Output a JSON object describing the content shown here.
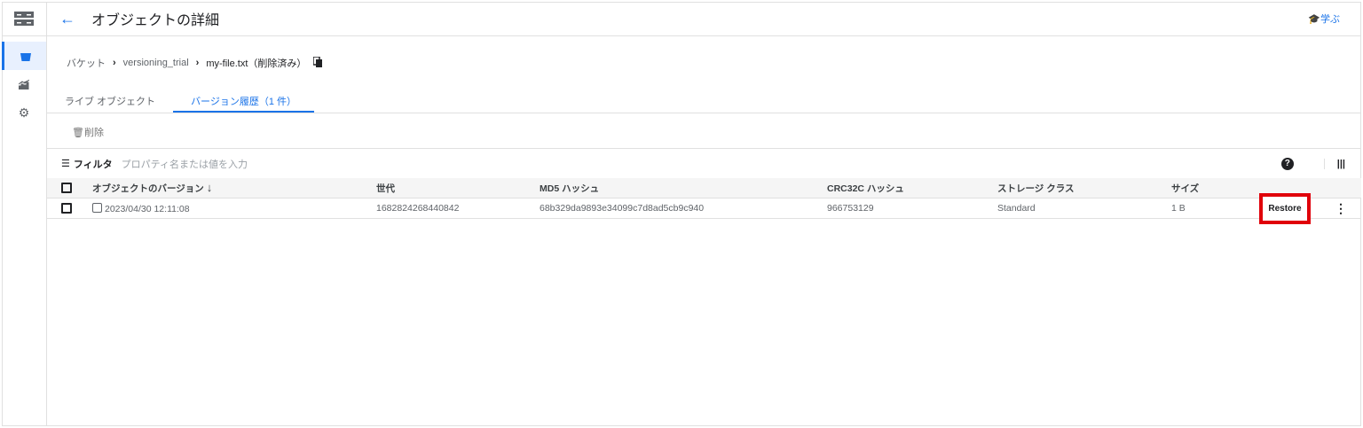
{
  "header": {
    "title": "オブジェクトの詳細",
    "learn": "学ぶ"
  },
  "breadcrumb": {
    "bucket": "バケット",
    "bucket_name": "versioning_trial",
    "object": "my-file.txt（削除済み）"
  },
  "tabs": [
    {
      "label": "ライブ オブジェクト"
    },
    {
      "label": "バージョン履歴（1 件）"
    }
  ],
  "toolbar": {
    "delete": "削除"
  },
  "filter": {
    "label": "フィルタ",
    "placeholder": "プロパティ名または値を入力"
  },
  "table": {
    "headers": [
      "オブジェクトのバージョン",
      "世代",
      "MD5 ハッシュ",
      "CRC32C ハッシュ",
      "ストレージ クラス",
      "サイズ"
    ],
    "rows": [
      {
        "version": "2023/04/30 12:11:08",
        "generation": "1682824268440842",
        "md5": "68b329da9893e34099c7d8ad5cb9c940",
        "crc32c": "966753129",
        "storage_class": "Standard",
        "size": "1 B",
        "action": "Restore"
      }
    ]
  },
  "colors": {
    "accent": "#1a73e8",
    "highlight": "#e0000a"
  }
}
